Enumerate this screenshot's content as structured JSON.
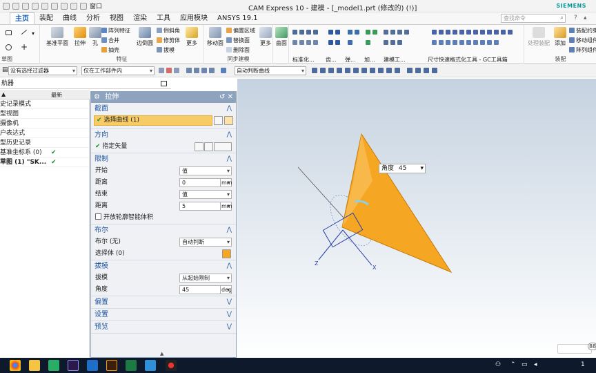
{
  "window": {
    "title": "CAM Express 10 - 建模 - [_model1.prt  (修改的)    (!)]",
    "brand": "SIEMENS",
    "window_menu": "窗口"
  },
  "menu": {
    "tabs": [
      "主页",
      "装配",
      "曲线",
      "分析",
      "视图",
      "渲染",
      "工具",
      "应用模块",
      "ANSYS 19.1"
    ],
    "search_placeholder": "查找命令"
  },
  "ribbon": {
    "sketch_group": "草图",
    "feature": {
      "datum_plane": "基准平面",
      "extrude": "拉伸",
      "hole": "孔",
      "pattern_feature": "阵列特征",
      "unite": "合并",
      "shell": "抽壳",
      "edge_blend": "边倒圆",
      "chamfer": "倒斜角",
      "trim_body": "修剪体",
      "draft": "拔模",
      "more": "更多",
      "label": "特征"
    },
    "sync": {
      "move_face": "移动面",
      "offset_region": "偏置区域",
      "replace_face": "替换面",
      "delete_face": "删除面",
      "more": "更多",
      "label": "同步建模"
    },
    "surface": {
      "surface": "曲面"
    },
    "bottom_groups": [
      "标准化...",
      "齿...",
      "弹...",
      "加...",
      "建模工...",
      "尺寸快速格式化工具 - GC工具箱"
    ],
    "assembly": {
      "add": "添加",
      "assembly_constraint": "装配约束",
      "move_component": "移动组件",
      "pattern_component": "阵列组件",
      "inactive": "处理装配",
      "label": "装配"
    }
  },
  "filterbar": {
    "filter": "没有选择过滤器",
    "scope": "仅在工作部件内",
    "curve_rule": "自动判断曲线"
  },
  "navigator": {
    "title": "航器",
    "col_latest": "最新",
    "rows": [
      {
        "label": "史记录模式",
        "check": ""
      },
      {
        "label": "型视图",
        "check": ""
      },
      {
        "label": "摄像机",
        "check": ""
      },
      {
        "label": "户表达式",
        "check": ""
      },
      {
        "label": "型历史记录",
        "check": ""
      },
      {
        "label": "基准坐标系 (0)",
        "check": "✔"
      },
      {
        "label": "草图 (1) \"SK...",
        "check": "✔"
      }
    ]
  },
  "dialog": {
    "title": "拉伸",
    "section": {
      "header": "截面",
      "select_curve": "选择曲线 (1)"
    },
    "direction": {
      "header": "方向",
      "specify_vector": "指定矢量"
    },
    "limits": {
      "header": "限制",
      "start_label": "开始",
      "start_value": "值",
      "distance_label": "距离",
      "start_distance": "0",
      "unit": "mm",
      "end_label": "结束",
      "end_value": "值",
      "end_distance": "5",
      "open_profile": "开放轮廓智能体积"
    },
    "boolean": {
      "header": "布尔",
      "boolean_label": "布尔 (无)",
      "boolean_value": "自动判断",
      "select_body": "选择体 (0)"
    },
    "draft": {
      "header": "拔模",
      "draft_label": "拔模",
      "draft_value": "从起始限制",
      "angle_label": "角度",
      "angle_value": "45",
      "angle_unit": "deg"
    },
    "offset_header": "偏置",
    "settings_header": "设置",
    "preview_header": "预览"
  },
  "viewport": {
    "angle_label": "角度",
    "angle_value": "45",
    "axis_x": "X",
    "axis_z": "Z",
    "cone_color": "#f5a623"
  },
  "taskbar": {
    "time": "1",
    "badge": "88"
  }
}
